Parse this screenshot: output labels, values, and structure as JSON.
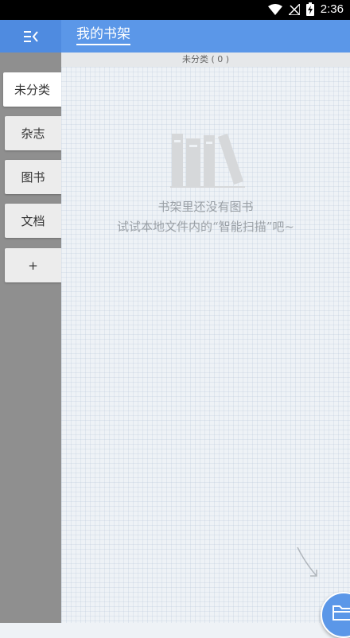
{
  "status_bar": {
    "time": "2:36"
  },
  "app_bar": {
    "title": "我的书架"
  },
  "sidebar": {
    "items": [
      {
        "label": "未分类",
        "active": true
      },
      {
        "label": "杂志",
        "active": false
      },
      {
        "label": "图书",
        "active": false
      },
      {
        "label": "文档",
        "active": false
      },
      {
        "label": "+",
        "active": false
      }
    ]
  },
  "main": {
    "category_header": "未分类 ( 0 )",
    "empty_title": "书架里还没有图书",
    "empty_hint": "试试本地文件内的“智能扫描”吧~"
  },
  "colors": {
    "accent": "#5b97e8",
    "sidebar": "#8f8f8f",
    "background": "#eef2f6"
  }
}
